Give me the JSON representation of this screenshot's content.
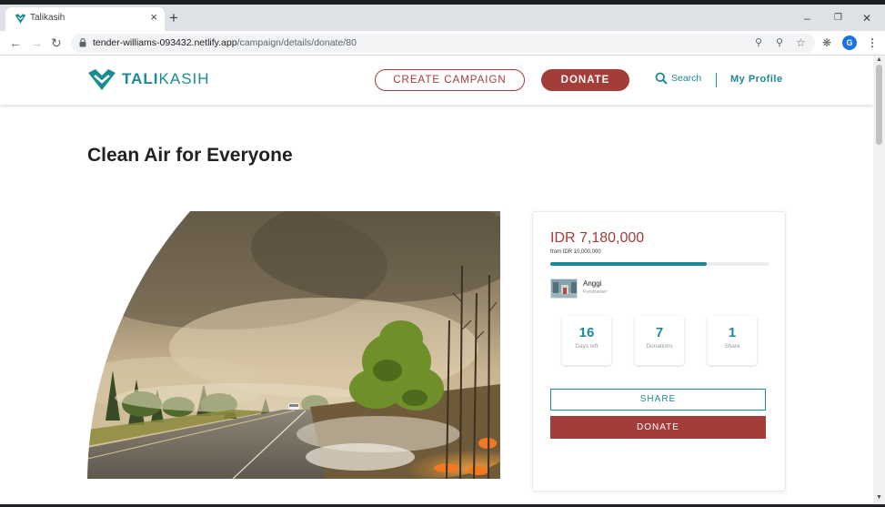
{
  "browser": {
    "tab_title": "Talikasih",
    "tab_close": "×",
    "new_tab": "+",
    "url_host": "tender-williams-093432.netlify.app",
    "url_path": "/campaign/details/donate/80",
    "profile_initial": "G"
  },
  "header": {
    "logo_bold": "TALI",
    "logo_light": "KASIH",
    "create_campaign_label": "CREATE CAMPAIGN",
    "donate_label": "DONATE",
    "search_label": "Search",
    "profile_label": "My Profile"
  },
  "campaign": {
    "title": "Clean Air for Everyone",
    "raised": "IDR 7,180,000",
    "target": "from IDR 10,000,000",
    "progress_fraction": 0.718,
    "fundraiser_name": "Anggi",
    "fundraiser_role": "Fundraiser",
    "stats": [
      {
        "value": "16",
        "label": "Days left"
      },
      {
        "value": "7",
        "label": "Donations"
      },
      {
        "value": "1",
        "label": "Share"
      }
    ],
    "share_label": "SHARE",
    "donate_label": "DONATE"
  },
  "colors": {
    "brand_teal": "#1a8a96",
    "brand_red": "#a43c3a"
  }
}
